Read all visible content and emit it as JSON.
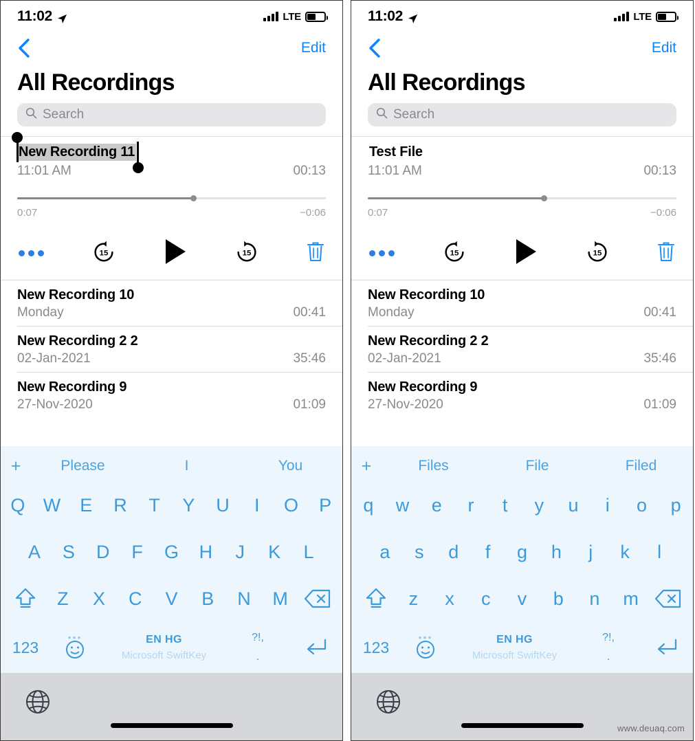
{
  "status_bar": {
    "time": "11:02",
    "location_icon": "location-arrow-icon",
    "signal_icon": "cellular-bars-icon",
    "network": "LTE",
    "battery_icon": "battery-icon"
  },
  "nav": {
    "back_icon": "chevron-left-icon",
    "edit_label": "Edit"
  },
  "page_title": "All Recordings",
  "search": {
    "icon": "search-icon",
    "placeholder": "Search"
  },
  "panels": [
    {
      "id": "before",
      "expanded_recording": {
        "name": "New Recording 11",
        "name_selected": true,
        "time": "11:01 AM",
        "duration": "00:13",
        "elapsed": "0:07",
        "remaining": "−0:06",
        "progress_percent": 57,
        "controls": {
          "more_icon": "more-options-icon",
          "rewind_label": "15",
          "rewind_icon": "skip-back-15-icon",
          "play_icon": "play-icon",
          "forward_label": "15",
          "forward_icon": "skip-forward-15-icon",
          "delete_icon": "trash-icon"
        }
      },
      "keyboard": {
        "plus": "+",
        "suggestions": [
          "Please",
          "I",
          "You"
        ],
        "row1": [
          "Q",
          "W",
          "E",
          "R",
          "T",
          "Y",
          "U",
          "I",
          "O",
          "P"
        ],
        "row2": [
          "A",
          "S",
          "D",
          "F",
          "G",
          "H",
          "J",
          "K",
          "L"
        ],
        "row3": [
          "Z",
          "X",
          "C",
          "V",
          "B",
          "N",
          "M"
        ],
        "shift_icon": "shift-up-icon",
        "backspace_icon": "backspace-icon",
        "numbers_label": "123",
        "emoji_icon": "emoji-smiley-icon",
        "space_language": "EN HG",
        "space_brand": "Microsoft SwiftKey",
        "punct_top": "?!,",
        "punct_bottom": ".",
        "enter_icon": "return-icon"
      }
    },
    {
      "id": "after",
      "expanded_recording": {
        "name": "Test File",
        "name_selected": false,
        "time": "11:01 AM",
        "duration": "00:13",
        "elapsed": "0:07",
        "remaining": "−0:06",
        "progress_percent": 57,
        "controls": {
          "more_icon": "more-options-icon",
          "rewind_label": "15",
          "rewind_icon": "skip-back-15-icon",
          "play_icon": "play-icon",
          "forward_label": "15",
          "forward_icon": "skip-forward-15-icon",
          "delete_icon": "trash-icon"
        }
      },
      "keyboard": {
        "plus": "+",
        "suggestions": [
          "Files",
          "File",
          "Filed"
        ],
        "row1": [
          "q",
          "w",
          "e",
          "r",
          "t",
          "y",
          "u",
          "i",
          "o",
          "p"
        ],
        "row2": [
          "a",
          "s",
          "d",
          "f",
          "g",
          "h",
          "j",
          "k",
          "l"
        ],
        "row3": [
          "z",
          "x",
          "c",
          "v",
          "b",
          "n",
          "m"
        ],
        "shift_icon": "shift-up-icon",
        "backspace_icon": "backspace-icon",
        "numbers_label": "123",
        "emoji_icon": "emoji-smiley-icon",
        "space_language": "EN HG",
        "space_brand": "Microsoft SwiftKey",
        "punct_top": "?!,",
        "punct_bottom": ".",
        "enter_icon": "return-icon"
      }
    }
  ],
  "recordings": [
    {
      "name": "New Recording 10",
      "date": "Monday",
      "duration": "00:41"
    },
    {
      "name": "New Recording 2 2",
      "date": "02-Jan-2021",
      "duration": "35:46"
    },
    {
      "name": "New Recording 9",
      "date": "27-Nov-2020",
      "duration": "01:09"
    }
  ],
  "bottom_bar": {
    "globe_icon": "globe-icon",
    "home_indicator": "home-indicator"
  },
  "watermark": "www.deuaq.com",
  "colors": {
    "accent_blue": "#0a84ff",
    "keyboard_blue": "#3d9ad9",
    "keyboard_bg": "#edf6fd",
    "muted_text": "#8a8a8e"
  }
}
